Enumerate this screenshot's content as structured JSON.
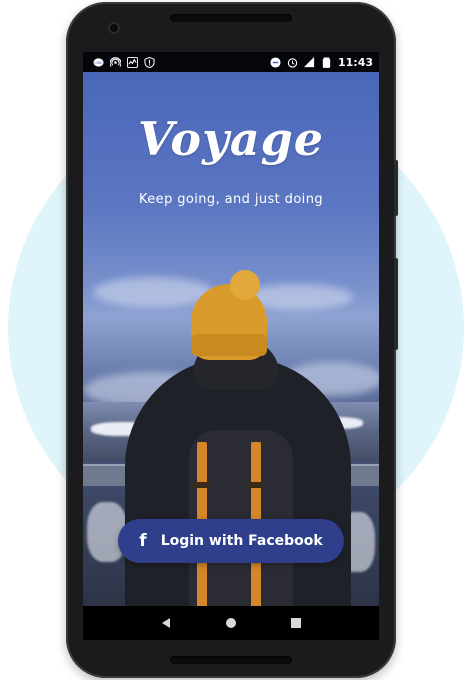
{
  "colors": {
    "accent_circle": "#dff4fb",
    "facebook_button": "#2f3f8c",
    "beanie": "#d89b2b"
  },
  "status_bar": {
    "left_icons": [
      "line-app-icon",
      "hotspot-icon",
      "activity-icon",
      "shield-alert-icon"
    ],
    "right_icons": [
      "do-not-disturb-icon",
      "alarm-icon",
      "signal-icon",
      "battery-icon"
    ],
    "time": "11:43"
  },
  "app": {
    "title": "Voyage",
    "tagline": "Keep going, and just doing"
  },
  "login": {
    "icon": "f",
    "label": "Login with Facebook"
  },
  "nav": {
    "icons": [
      "back-icon",
      "home-icon",
      "recents-icon"
    ]
  }
}
